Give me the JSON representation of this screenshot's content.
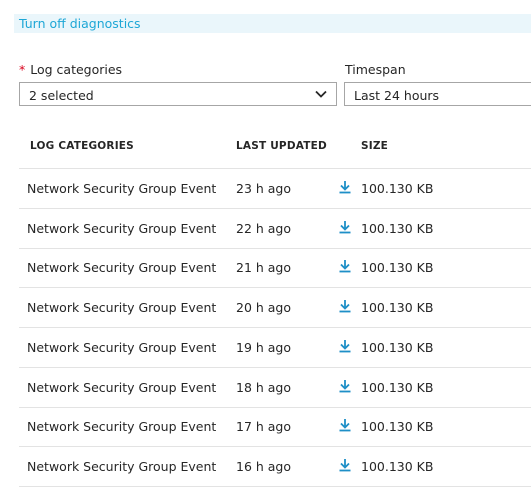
{
  "top_link": "Turn off diagnostics",
  "form": {
    "log_categories_label": "Log categories",
    "required_marker": "*",
    "log_categories_value": "2 selected",
    "timespan_label": "Timespan",
    "timespan_value": "Last 24 hours"
  },
  "table": {
    "headers": [
      "LOG CATEGORIES",
      "LAST UPDATED",
      "SIZE"
    ],
    "rows": [
      {
        "category": "Network Security Group Event",
        "updated": "23 h ago",
        "size": "100.130 KB"
      },
      {
        "category": "Network Security Group Event",
        "updated": "22 h ago",
        "size": "100.130 KB"
      },
      {
        "category": "Network Security Group Event",
        "updated": "21 h ago",
        "size": "100.130 KB"
      },
      {
        "category": "Network Security Group Event",
        "updated": "20 h ago",
        "size": "100.130 KB"
      },
      {
        "category": "Network Security Group Event",
        "updated": "19 h ago",
        "size": "100.130 KB"
      },
      {
        "category": "Network Security Group Event",
        "updated": "18 h ago",
        "size": "100.130 KB"
      },
      {
        "category": "Network Security Group Event",
        "updated": "17 h ago",
        "size": "100.130 KB"
      },
      {
        "category": "Network Security Group Event",
        "updated": "16 h ago",
        "size": "100.130 KB"
      }
    ]
  },
  "icons": {
    "download": "download-icon",
    "dropdown": "chevron-down-icon"
  },
  "colors": {
    "link": "#1ea7d6",
    "download_icon": "#1e8fc7",
    "required": "#d9001b"
  }
}
